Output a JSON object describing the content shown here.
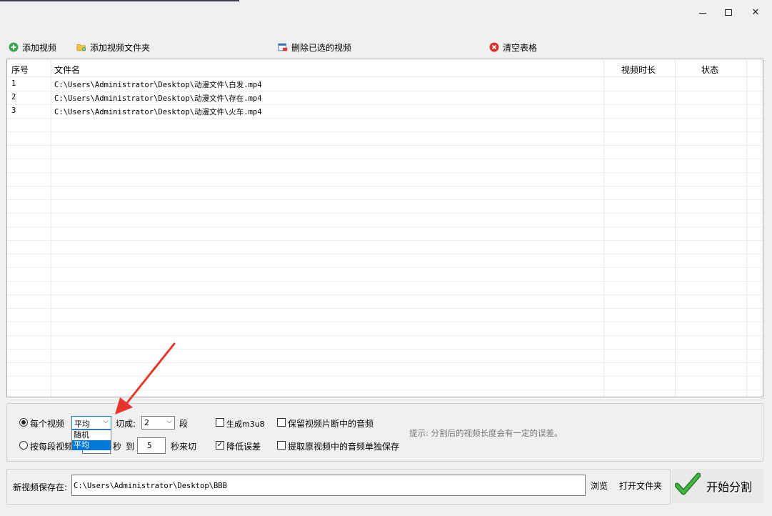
{
  "window": {
    "minimize_glyph": "—",
    "maximize_glyph": "□",
    "close_glyph": "✕"
  },
  "toolbar": {
    "add_video": "添加视频",
    "add_folder": "添加视频文件夹",
    "delete_selected": "删除已选的视频",
    "clear_table": "清空表格"
  },
  "table": {
    "columns": [
      "序号",
      "文件名",
      "视频时长",
      "状态"
    ],
    "rows": [
      {
        "index": "1",
        "file": "C:\\Users\\Administrator\\Desktop\\动漫文件\\白发.mp4",
        "duration": "",
        "status": ""
      },
      {
        "index": "2",
        "file": "C:\\Users\\Administrator\\Desktop\\动漫文件\\存在.mp4",
        "duration": "",
        "status": ""
      },
      {
        "index": "3",
        "file": "C:\\Users\\Administrator\\Desktop\\动漫文件\\火车.mp4",
        "duration": "",
        "status": ""
      }
    ]
  },
  "options": {
    "per_video_label": "每个视频",
    "mode_value": "平均",
    "mode_options": [
      "随机",
      "平均"
    ],
    "mode_selected": "平均",
    "split_into_label": "切成:",
    "segments_value": "2",
    "segments_unit": "段",
    "per_segment_label": "按每段视频",
    "sec_label": "秒",
    "to_label": "到",
    "to_value": "5",
    "sec_cut_label": "秒来切",
    "gen_m3u8": "生成m3u8",
    "gen_m3u8_checked": false,
    "keep_audio": "保留视频片断中的音频",
    "keep_audio_checked": false,
    "reduce_error": "降低误差",
    "reduce_error_checked": true,
    "extract_audio": "提取原视频中的音频单独保存",
    "extract_audio_checked": false,
    "hint": "提示: 分割后的视频长度会有一定的误差。"
  },
  "save": {
    "label": "新视频保存在:",
    "path": "C:\\Users\\Administrator\\Desktop\\BBB",
    "browse": "浏览",
    "open_folder": "打开文件夹",
    "start": "开始分割"
  },
  "colors": {
    "accent": "#0078d7",
    "annotation_arrow": "#e8352b",
    "check_green": "#2e9e2e"
  }
}
